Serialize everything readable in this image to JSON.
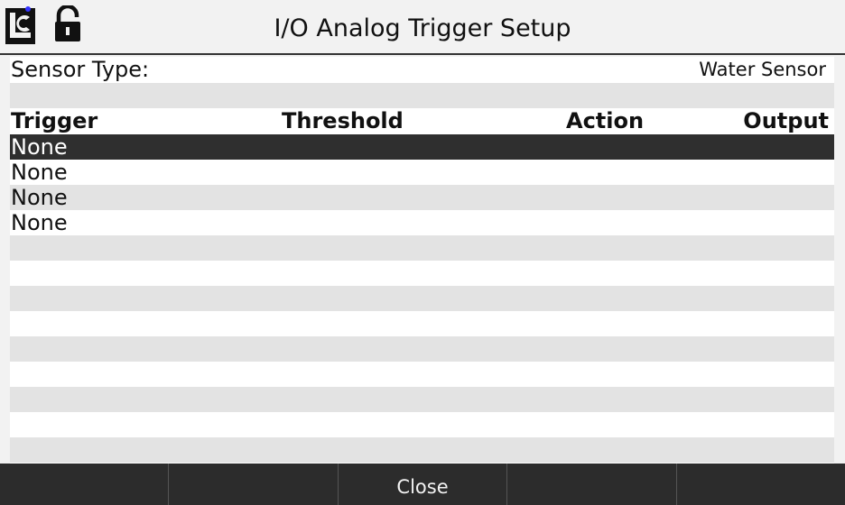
{
  "header": {
    "title": "I/O Analog Trigger Setup",
    "logo_icon": "lc-logo-icon",
    "lock_icon": "unlocked-padlock-icon",
    "logo_dot_color": "#3333ff"
  },
  "sensor": {
    "label": "Sensor Type:",
    "value": "Water Sensor"
  },
  "table": {
    "columns": [
      "Trigger",
      "Threshold",
      "Action",
      "Output"
    ],
    "rows": [
      {
        "trigger": "None",
        "selected": true
      },
      {
        "trigger": "None",
        "selected": false
      },
      {
        "trigger": "None",
        "selected": false
      },
      {
        "trigger": "None",
        "selected": false
      }
    ]
  },
  "softkeys": [
    "",
    "",
    "Close",
    "",
    ""
  ],
  "colors": {
    "background": "#f2f2f2",
    "panel": "#ffffff",
    "stripe": "#e3e3e3",
    "selected_row": "#2f2f2f",
    "bottom_bar": "#2c2c2c"
  }
}
